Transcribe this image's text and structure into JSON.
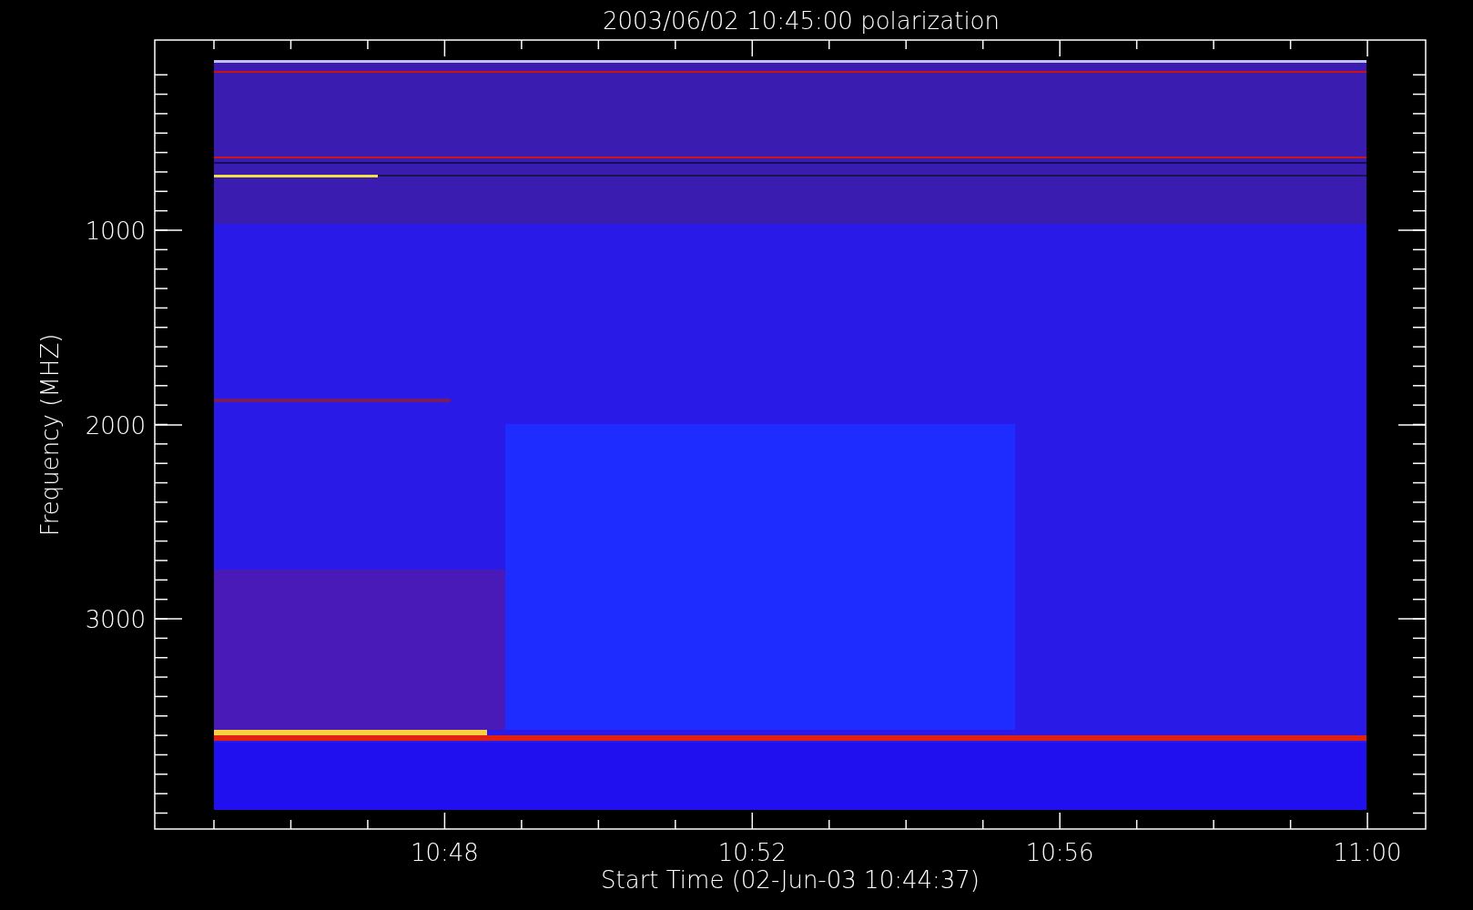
{
  "title": "2003/06/02 10:45:00 polarization",
  "y_axis": {
    "label": "Frequency (MHZ)",
    "ticks": [
      "1000",
      "2000",
      "3000"
    ]
  },
  "x_axis": {
    "label": "Start Time (02-Jun-03 10:44:37)",
    "ticks": [
      "10:48",
      "10:52",
      "10:56",
      "11:00"
    ]
  }
}
